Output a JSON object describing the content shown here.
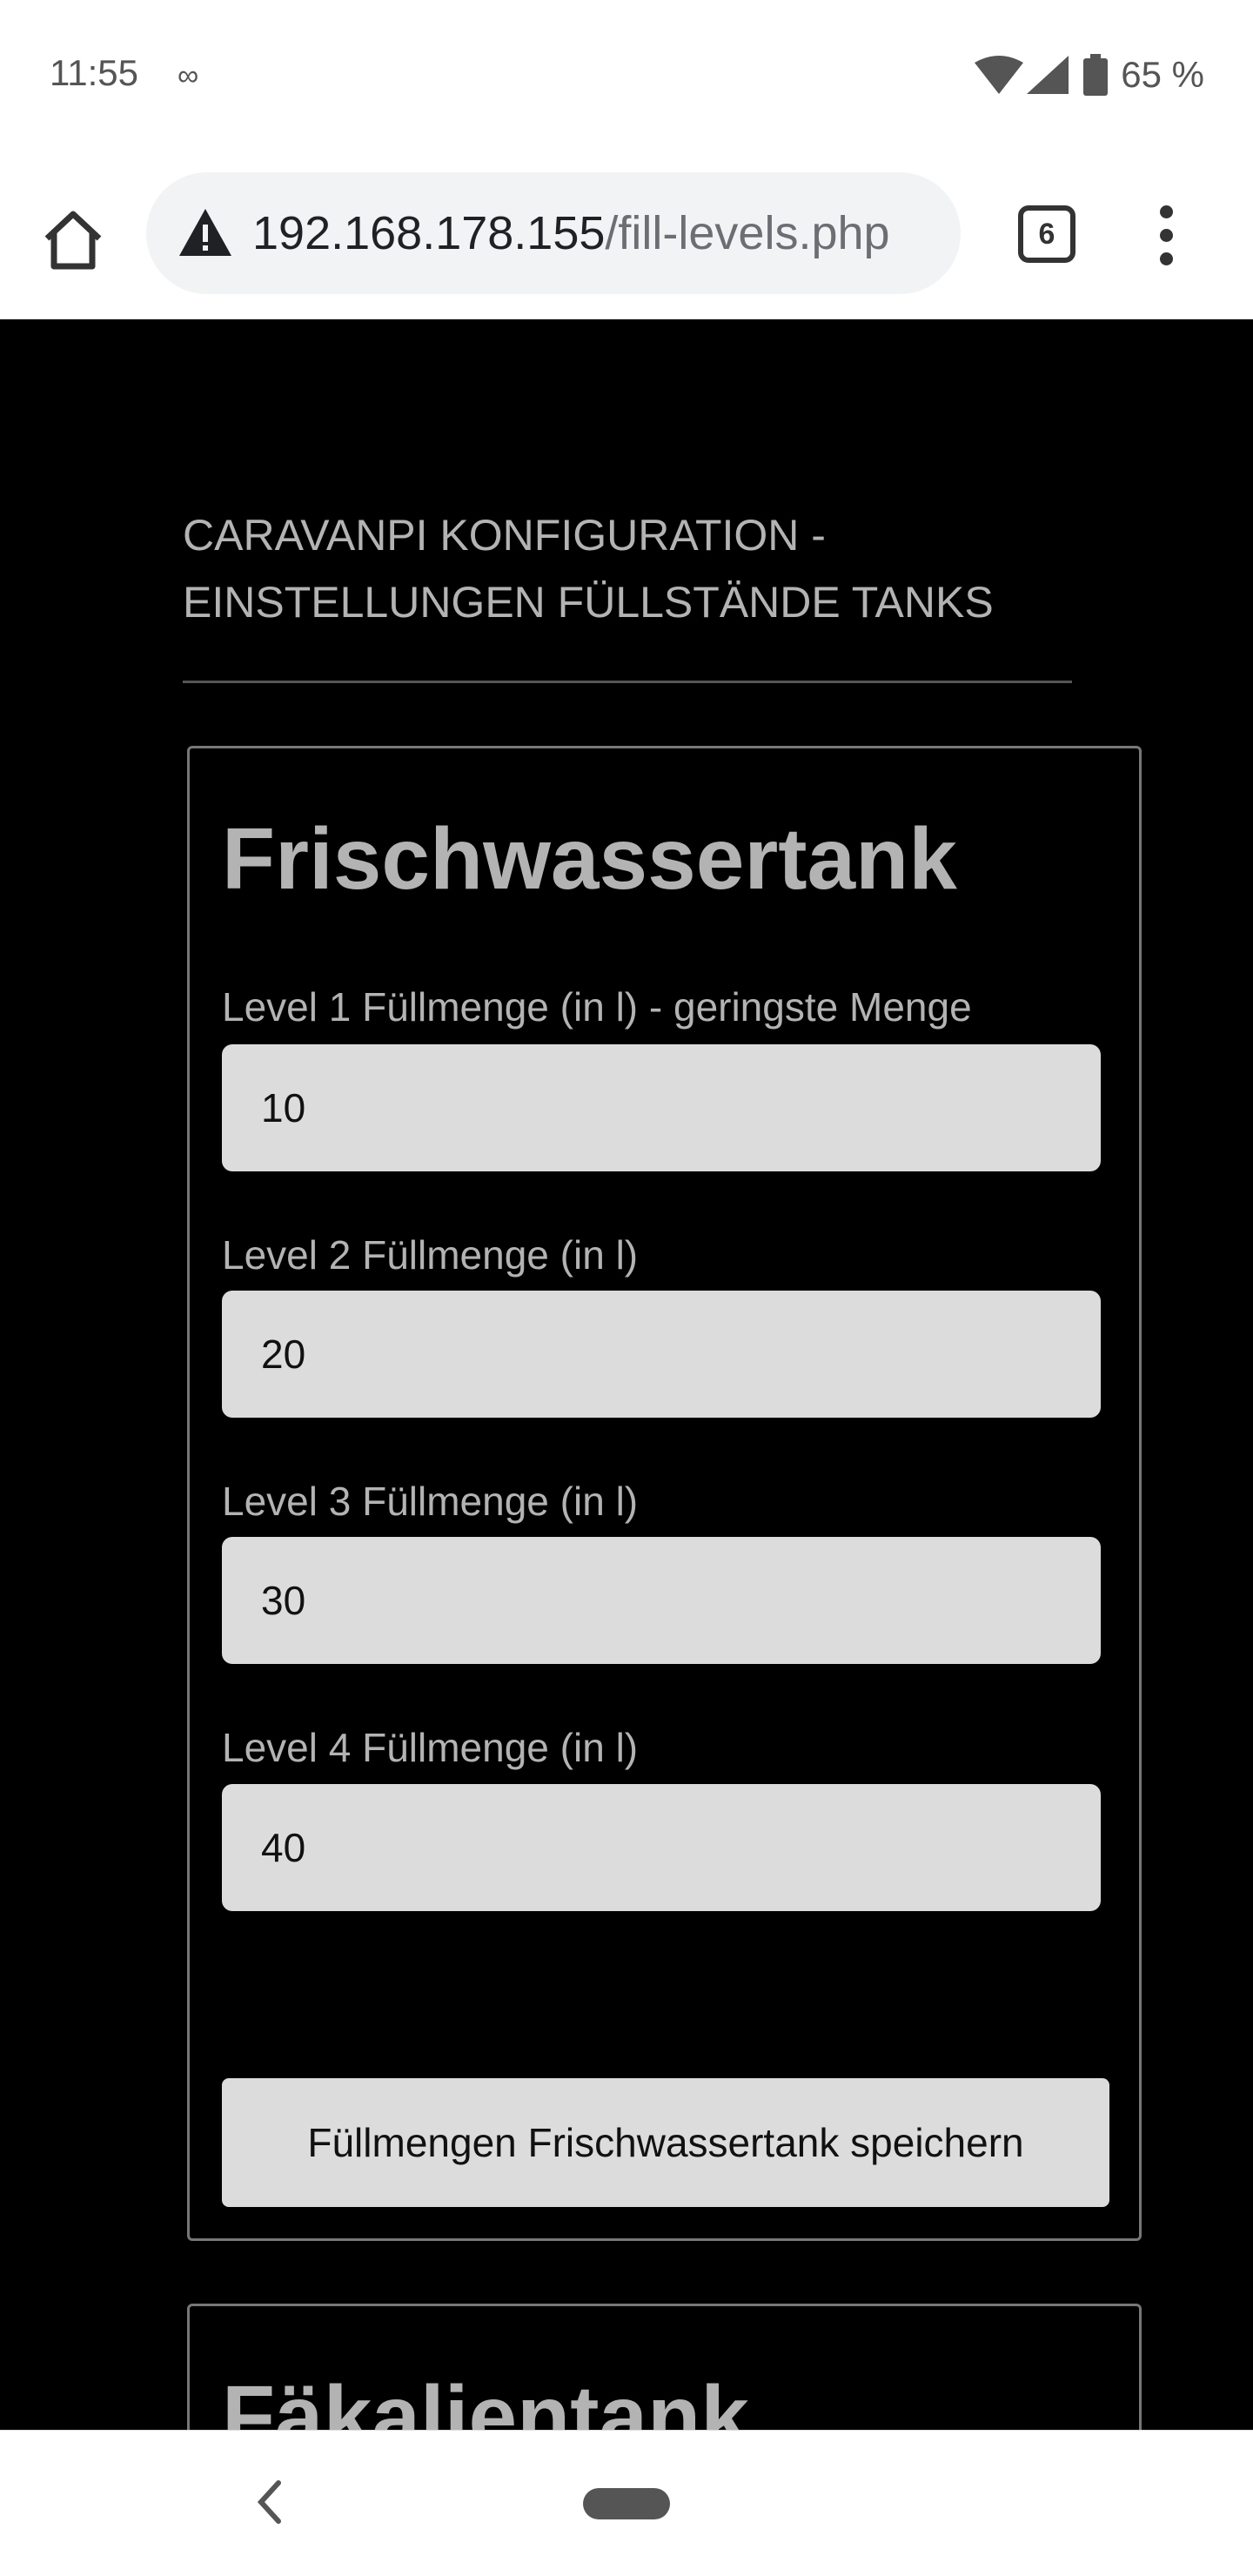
{
  "status_bar": {
    "time": "11:55",
    "voicemail_glyph": "∞",
    "battery": "65 %"
  },
  "browser": {
    "url_host": "192.168.178.155",
    "url_path": "/fill-levels.php",
    "tab_count": "6"
  },
  "page": {
    "heading": "CARAVANPI KONFIGURATION - EINSTELLUNGEN FÜLLSTÄNDE TANKS",
    "fresh_tank": {
      "title": "Frischwassertank",
      "fields": [
        {
          "label": "Level 1 Füllmenge (in l) - geringste Menge",
          "value": "10"
        },
        {
          "label": "Level 2 Füllmenge (in l)",
          "value": "20"
        },
        {
          "label": "Level 3 Füllmenge (in l)",
          "value": "30"
        },
        {
          "label": "Level 4 Füllmenge (in l)",
          "value": "40"
        }
      ],
      "save_label": "Füllmengen Frischwassertank speichern"
    },
    "waste_tank": {
      "title": "Fäkalientank"
    }
  }
}
